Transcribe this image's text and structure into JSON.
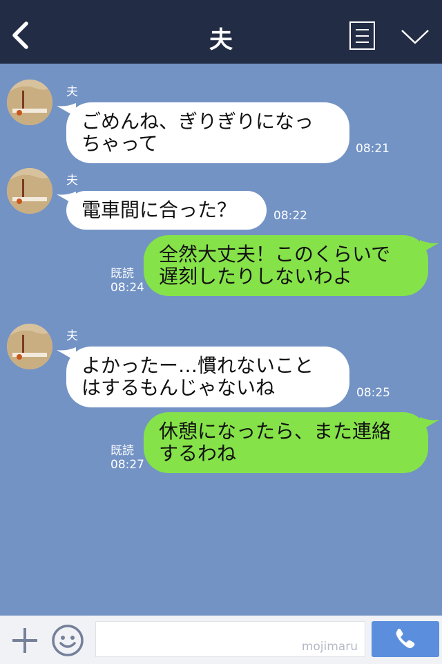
{
  "header": {
    "title": "夫",
    "back_icon": "chevron-left-icon",
    "menu_icon": "list-icon",
    "collapse_icon": "chevron-down-icon"
  },
  "messages": [
    {
      "sender": "夫",
      "direction": "incoming",
      "lines": [
        "ごめんね、ぎりぎりになっ",
        "ちゃって"
      ],
      "time": "08:21"
    },
    {
      "sender": "夫",
      "direction": "incoming",
      "lines": [
        "電車間に合った？"
      ],
      "time": "08:22"
    },
    {
      "direction": "outgoing",
      "lines": [
        "全然大丈夫！このくらいで",
        "遅刻したりしないわよ"
      ],
      "read": "既読",
      "time": "08:24"
    },
    {
      "sender": "夫",
      "direction": "incoming",
      "lines": [
        "よかったー…慣れないこと",
        "はするもんじゃないね"
      ],
      "time": "08:25"
    },
    {
      "direction": "outgoing",
      "lines": [
        "休憩になったら、また連絡",
        "するわね"
      ],
      "read": "既読",
      "time": "08:27"
    }
  ],
  "footer": {
    "input_value": "",
    "watermark": "mojimaru",
    "plus_icon": "plus-icon",
    "emoji_icon": "smiley-icon",
    "call_icon": "phone-icon"
  },
  "colors": {
    "header": "#232c45",
    "chat_background": "#7393c5",
    "incoming_bubble": "#ffffff",
    "outgoing_bubble": "#85e249",
    "call_button": "#5b8fde"
  }
}
